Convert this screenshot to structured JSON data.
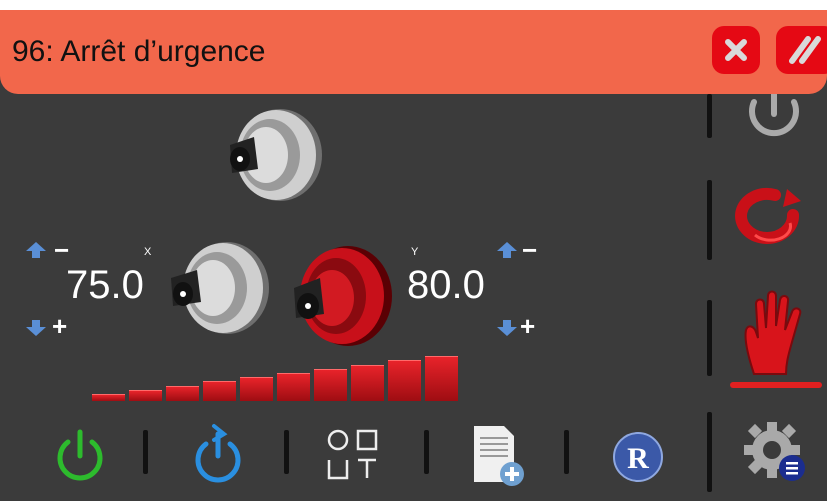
{
  "alarm": {
    "title": "96: Arrêt d’urgence",
    "color": "#f2674b"
  },
  "axes": {
    "x": {
      "label": "X",
      "value": "75.0"
    },
    "y": {
      "label": "Y",
      "value": "80.0"
    }
  },
  "adjust": {
    "minus": "−",
    "plus": "+"
  },
  "level_bars": {
    "count": 10,
    "active": 10
  },
  "toolbar": {
    "bottom": [
      "power-green-icon",
      "power-cycle-blue-icon",
      "shape-select-icon",
      "add-program-icon",
      "reference-r-icon"
    ],
    "side": [
      "power-gray-icon",
      "rotate-icon",
      "stop-hand-icon",
      "settings-gear-icon"
    ],
    "selected_side": "stop-hand-icon"
  }
}
